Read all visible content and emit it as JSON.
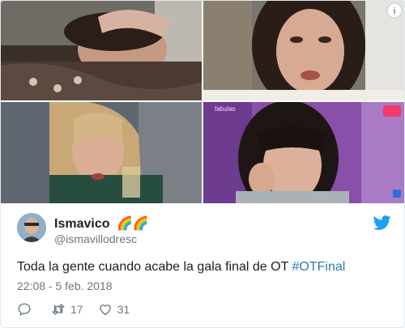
{
  "media": {
    "photos": [
      {
        "icon": "photo-woman-lying-down"
      },
      {
        "icon": "photo-woman-crying"
      },
      {
        "icon": "photo-blonde-woman-drinking"
      },
      {
        "icon": "photo-woman-hand-on-head"
      }
    ],
    "overlay_text": "fabulas"
  },
  "tweet": {
    "display_name": "Ismavico",
    "name_emoji": "🌈🌈",
    "handle": "@ismavillodresc",
    "text_prefix": "Toda la gente cuando acabe la gala final de OT ",
    "hashtag": "#OTFinal",
    "timestamp": "22:08 - 5 feb. 2018",
    "retweets": "17",
    "likes": "31"
  },
  "colors": {
    "twitter_blue": "#1da1f2",
    "link": "#2b7bb9",
    "secondary_text": "#697882"
  },
  "icons": {
    "brand": "twitter-bird-icon",
    "reply": "reply-icon",
    "retweet": "retweet-icon",
    "like": "heart-icon"
  }
}
